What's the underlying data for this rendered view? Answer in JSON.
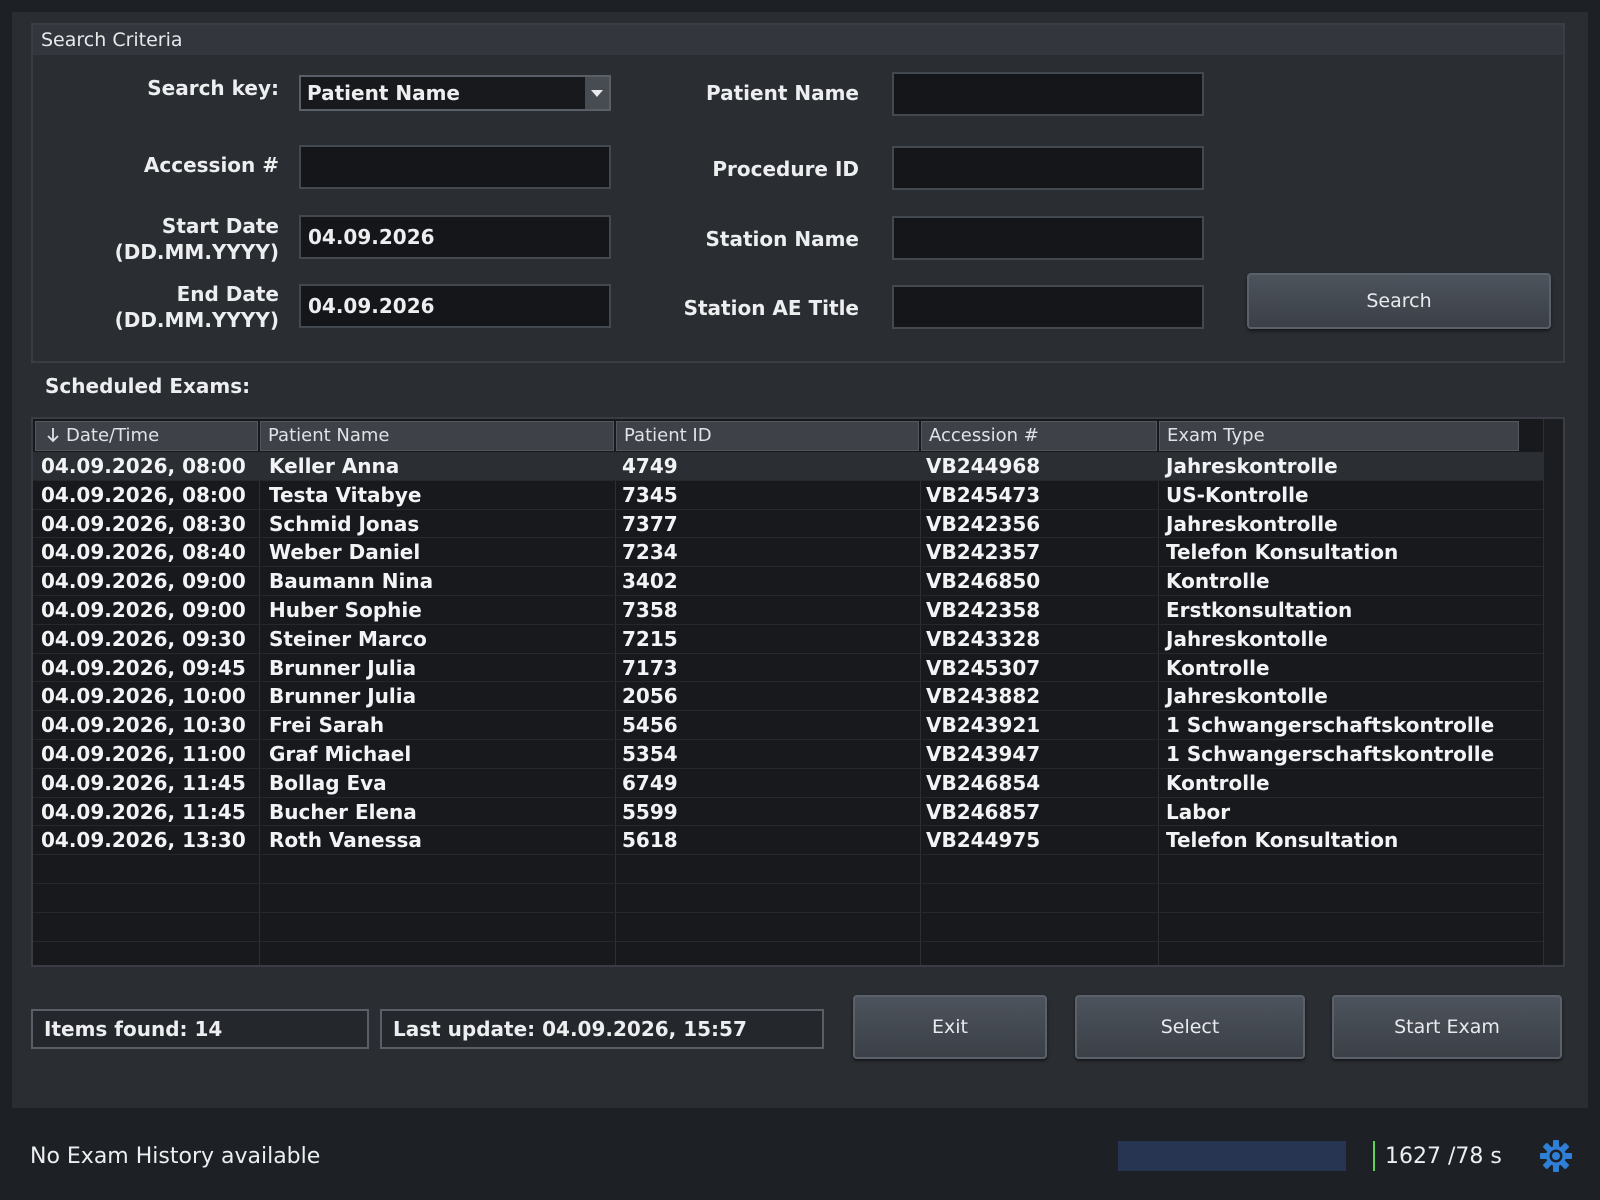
{
  "search_criteria": {
    "title": "Search Criteria",
    "search_key_label": "Search key:",
    "search_key_value": "Patient Name",
    "accession_label": "Accession #",
    "accession_value": "",
    "start_date_label_1": "Start Date",
    "start_date_label_2": "(DD.MM.YYYY)",
    "start_date_value": "04.09.2026",
    "end_date_label_1": "End Date",
    "end_date_label_2": "(DD.MM.YYYY)",
    "end_date_value": "04.09.2026",
    "patient_name_label": "Patient Name",
    "patient_name_value": "",
    "procedure_id_label": "Procedure ID",
    "procedure_id_value": "",
    "station_name_label": "Station Name",
    "station_name_value": "",
    "station_ae_label": "Station AE Title",
    "station_ae_value": "",
    "search_button": "Search"
  },
  "exams": {
    "title": "Scheduled Exams:",
    "sort_icon": "arrow-down-icon",
    "columns": [
      "Date/Time",
      "Patient Name",
      "Patient ID",
      "Accession #",
      "Exam Type"
    ],
    "rows": [
      [
        "04.09.2026, 08:00",
        "Keller Anna",
        "4749",
        "VB244968",
        "Jahreskontrolle"
      ],
      [
        "04.09.2026, 08:00",
        "Testa Vitabye",
        "7345",
        "VB245473",
        "US-Kontrolle"
      ],
      [
        "04.09.2026, 08:30",
        "Schmid Jonas",
        "7377",
        "VB242356",
        "Jahreskontrolle"
      ],
      [
        "04.09.2026, 08:40",
        "Weber Daniel",
        "7234",
        "VB242357",
        "Telefon Konsultation"
      ],
      [
        "04.09.2026, 09:00",
        "Baumann Nina",
        "3402",
        "VB246850",
        "Kontrolle"
      ],
      [
        "04.09.2026, 09:00",
        "Huber Sophie",
        "7358",
        "VB242358",
        "Erstkonsultation"
      ],
      [
        "04.09.2026, 09:30",
        "Steiner Marco",
        "7215",
        "VB243328",
        "Jahreskontolle"
      ],
      [
        "04.09.2026, 09:45",
        "Brunner Julia",
        "7173",
        "VB245307",
        "Kontrolle"
      ],
      [
        "04.09.2026, 10:00",
        "Brunner Julia",
        "2056",
        "VB243882",
        "Jahreskontolle"
      ],
      [
        "04.09.2026, 10:30",
        "Frei Sarah",
        "5456",
        "VB243921",
        "1 Schwangerschaftskontrolle"
      ],
      [
        "04.09.2026, 11:00",
        "Graf Michael",
        "5354",
        "VB243947",
        "1 Schwangerschaftskontrolle"
      ],
      [
        "04.09.2026, 11:45",
        "Bollag Eva",
        "6749",
        "VB246854",
        "Kontrolle"
      ],
      [
        "04.09.2026, 11:45",
        "Bucher Elena",
        "5599",
        "VB246857",
        "Labor"
      ],
      [
        "04.09.2026, 13:30",
        "Roth Vanessa",
        "5618",
        "VB244975",
        "Telefon Konsultation"
      ]
    ],
    "empty_rows": 4
  },
  "footer": {
    "items_found": "Items found: 14",
    "last_update": "Last update: 04.09.2026, 15:57",
    "exit_button": "Exit",
    "select_button": "Select",
    "start_exam_button": "Start Exam"
  },
  "status_bar": {
    "history_text": "No Exam History available",
    "progress_fraction": 0.89,
    "progress_text": "1627 /78 s",
    "settings_icon": "gear-icon",
    "accent_color": "#2f7fd6",
    "progress_color": "#273552",
    "marker_color": "#5ed35a"
  }
}
